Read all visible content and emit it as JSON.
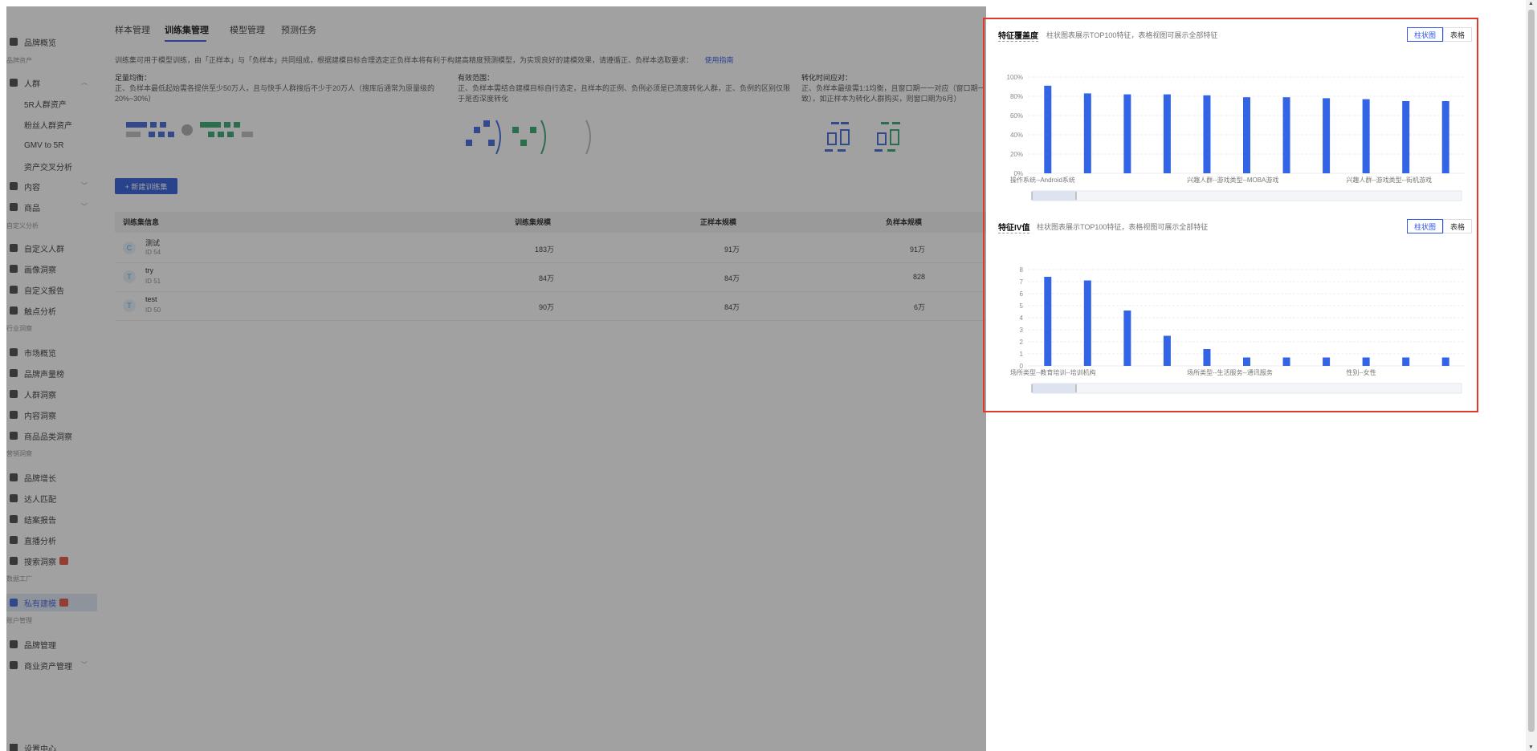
{
  "sidebar": {
    "items": [
      {
        "label": "品牌概览",
        "kind": "item",
        "icon": "grid-icon"
      },
      {
        "label": "品牌资产",
        "kind": "group"
      },
      {
        "label": "人群",
        "kind": "item",
        "icon": "people-icon",
        "chevron": "up"
      },
      {
        "label": "5R人群资产",
        "kind": "sub"
      },
      {
        "label": "粉丝人群资产",
        "kind": "sub"
      },
      {
        "label": "GMV to 5R",
        "kind": "sub"
      },
      {
        "label": "资产交叉分析",
        "kind": "sub"
      },
      {
        "label": "内容",
        "kind": "item",
        "icon": "content-icon",
        "chevron": "down"
      },
      {
        "label": "商品",
        "kind": "item",
        "icon": "goods-icon",
        "chevron": "down"
      },
      {
        "label": "自定义分析",
        "kind": "group"
      },
      {
        "label": "自定义人群",
        "kind": "item",
        "icon": "custom-people-icon"
      },
      {
        "label": "画像洞察",
        "kind": "item",
        "icon": "portrait-icon"
      },
      {
        "label": "自定义报告",
        "kind": "item",
        "icon": "report-icon"
      },
      {
        "label": "触点分析",
        "kind": "item",
        "icon": "touchpoint-icon"
      },
      {
        "label": "行业洞察",
        "kind": "group"
      },
      {
        "label": "市场概览",
        "kind": "item",
        "icon": "market-icon"
      },
      {
        "label": "品牌声量榜",
        "kind": "item",
        "icon": "rank-icon"
      },
      {
        "label": "人群洞察",
        "kind": "item",
        "icon": "crowd-icon"
      },
      {
        "label": "内容洞察",
        "kind": "item",
        "icon": "content-insight-icon"
      },
      {
        "label": "商品品类洞察",
        "kind": "item",
        "icon": "category-icon"
      },
      {
        "label": "营销洞察",
        "kind": "group"
      },
      {
        "label": "品牌增长",
        "kind": "item",
        "icon": "growth-icon"
      },
      {
        "label": "达人匹配",
        "kind": "item",
        "icon": "match-icon"
      },
      {
        "label": "结案报告",
        "kind": "item",
        "icon": "closing-report-icon"
      },
      {
        "label": "直播分析",
        "kind": "item",
        "icon": "live-icon"
      },
      {
        "label": "搜索洞察",
        "kind": "item",
        "icon": "search-icon",
        "badge": true
      },
      {
        "label": "数据工厂",
        "kind": "group"
      },
      {
        "label": "私有建模",
        "kind": "item",
        "icon": "model-icon",
        "badge": true,
        "active": true
      },
      {
        "label": "账户管理",
        "kind": "group"
      },
      {
        "label": "品牌管理",
        "kind": "item",
        "icon": "brand-icon"
      },
      {
        "label": "商业资产管理",
        "kind": "item",
        "icon": "asset-icon",
        "chevron": "down"
      }
    ],
    "settings": {
      "label": "设置中心"
    }
  },
  "tabs": [
    "样本管理",
    "训练集管理",
    "模型管理",
    "预测任务"
  ],
  "description": "训练集可用于模型训练，由「正样本」与「负样本」共同组成，根据建模目标合理选定正负样本将有利于构建高精度预测模型，为实现良好的建模效果，请遵循正、负样本选取要求：",
  "guide_link": "使用指南",
  "requirements": [
    {
      "title": "足量均衡：",
      "text": "正、负样本最低起始需各提供至少50万人，且与快手人群搜后不少于20万人（搜库后通常为原量级的20%~30%）"
    },
    {
      "title": "有效范围：",
      "text": "正、负样本需结合建模目标自行选定，且样本的正例、负例必须是已流度转化人群，正、负例的区别仅限于是否深度转化"
    },
    {
      "title": "转化时间应对：",
      "text": "正、负样本最级需1:1均衡，且窗口期一一对应（窗口期一致），如正样本为转化人群购买，则窗口期为6月）"
    }
  ],
  "new_button": "+ 新建训练集",
  "table": {
    "headers": [
      "训练集信息",
      "训练集规模",
      "正样本规模",
      "负样本规模"
    ],
    "rows": [
      {
        "avatar": "C",
        "name": "测试",
        "id": "ID 54",
        "size": "183万",
        "pos": "91万",
        "neg": "91万"
      },
      {
        "avatar": "T",
        "name": "try",
        "id": "ID 51",
        "size": "84万",
        "pos": "84万",
        "neg": "828"
      },
      {
        "avatar": "T",
        "name": "test",
        "id": "ID 50",
        "size": "90万",
        "pos": "84万",
        "neg": "6万"
      }
    ]
  },
  "cards": [
    {
      "title": "特征覆盖度",
      "subtitle": "柱状图表展示TOP100特征，表格视图可展示全部特征",
      "toggle": [
        "柱状图",
        "表格"
      ]
    },
    {
      "title": "特征IV值",
      "subtitle": "柱状图表展示TOP100特征，表格视图可展示全部特征",
      "toggle": [
        "柱状图",
        "表格"
      ]
    }
  ],
  "chart_data": [
    {
      "type": "bar",
      "title": "特征覆盖度",
      "yticks": [
        "0%",
        "20%",
        "40%",
        "60%",
        "80%",
        "100%"
      ],
      "ylim": [
        0,
        100
      ],
      "x_tick_labels": [
        "操作系统--Android系统",
        "兴趣人群--游戏类型--MOBA游戏",
        "兴趣人群--游戏类型--街机游戏"
      ],
      "label_positions": [
        0,
        4,
        8
      ],
      "values": [
        91,
        83,
        82,
        82,
        81,
        79,
        79,
        78,
        77,
        75,
        75
      ],
      "color": "#3464e6"
    },
    {
      "type": "bar",
      "title": "特征IV值",
      "yticks": [
        "0",
        "1",
        "2",
        "3",
        "4",
        "5",
        "6",
        "7",
        "8"
      ],
      "ylim": [
        0,
        8
      ],
      "x_tick_labels": [
        "场所类型--教育培训--培训机构",
        "场所类型--生活服务--通讯服务",
        "性别--女性"
      ],
      "label_positions": [
        0,
        4,
        8
      ],
      "values": [
        7.4,
        7.1,
        4.6,
        2.5,
        1.4,
        0.7,
        0.7,
        0.7,
        0.7,
        0.7,
        0.7
      ],
      "color": "#3464e6"
    }
  ]
}
